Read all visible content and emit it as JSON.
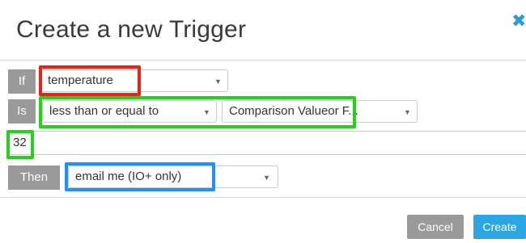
{
  "dialog": {
    "title": "Create a new Trigger",
    "close_icon": "close-icon"
  },
  "rows": {
    "if": {
      "label": "If",
      "select_value": "temperature"
    },
    "is": {
      "label": "Is",
      "operator_value": "less than or equal to",
      "comparison_value": "Comparison Value",
      "comparison_suffix": "or F..."
    },
    "value": {
      "input_value": "32"
    },
    "then": {
      "label": "Then",
      "action_value": "email me (IO+ only)"
    }
  },
  "footer": {
    "cancel_label": "Cancel",
    "create_label": "Create"
  },
  "colors": {
    "highlight_red": "#e8231a",
    "highlight_green": "#27d11b",
    "highlight_blue": "#1e90ff",
    "accent": "#2aa7e2",
    "tag_gray": "#9a9a9a"
  }
}
